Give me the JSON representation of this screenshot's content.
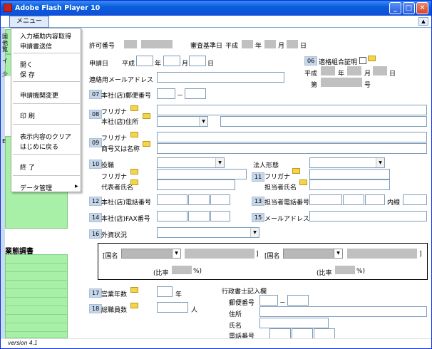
{
  "window": {
    "title": "Adobe Flash Player 10"
  },
  "menubar": {
    "menu_label": "メニュー"
  },
  "dropdown": {
    "items": [
      "入力補助内容取得",
      "申請書送信",
      "開く",
      "保 存",
      "申請機関変更",
      "印 刷",
      "表示内容のクリア",
      "はじめに戻る",
      "終 了",
      "データ管理"
    ],
    "submenu_arrow": "▶"
  },
  "sidebar": {
    "stub_chars": [
      "国",
      "他",
      "覧",
      "イ",
      "少",
      "E"
    ],
    "business_survey_label": "業態調書"
  },
  "form": {
    "permit_no_label": "許可番号",
    "review_date_label": "審査基準日",
    "era": "平成",
    "year": "年",
    "month": "月",
    "day": "日",
    "apply_date_label": "申請日",
    "email_contact_label": "連絡用メールアドレス",
    "union_cert_label": "適格組合証明",
    "number_unit": "号",
    "dai": "第",
    "hq_postal_label": "本社(店)郵便番号",
    "dash": "－",
    "furigana": "フリガナ",
    "hq_address_label": "本社(店)住所",
    "trade_name_label": "商号又は名称",
    "position_label": "役職",
    "rep_name_label": "代表者氏名",
    "corp_type_label": "法人形態",
    "contact_name_label": "担当者氏名",
    "hq_phone_label": "本社(店)電話番号",
    "contact_phone_label": "担当者電話番号",
    "extension_label": "内線",
    "hq_fax_label": "本社(店)FAX番号",
    "email_label": "メールアドレス",
    "foreign_status_label": "外資状況",
    "country_label": "[国名",
    "bracket_close": "]",
    "ratio_label": "(比率",
    "percent_close": "%)",
    "years_in_business_label": "営業年数",
    "total_staff_label": "総職員数",
    "person_unit": "人",
    "scrivener_section_label": "行政書士記入欄",
    "postal_label": "郵便番号",
    "address_label": "住所",
    "name_label": "氏名",
    "phone_label": "電話番号",
    "section_numbers": [
      "06",
      "07",
      "08",
      "09",
      "10",
      "11",
      "12",
      "13",
      "14",
      "15",
      "16",
      "17",
      "18"
    ]
  },
  "status": {
    "version": "version 4.1"
  },
  "colors": {
    "title_blue": "#0a5ddc",
    "sidebar_green": "#a8f0a8",
    "field_gray": "#c0c0c0",
    "number_tag": "#c6d6ea",
    "memo_yellow": "#f5d547"
  }
}
